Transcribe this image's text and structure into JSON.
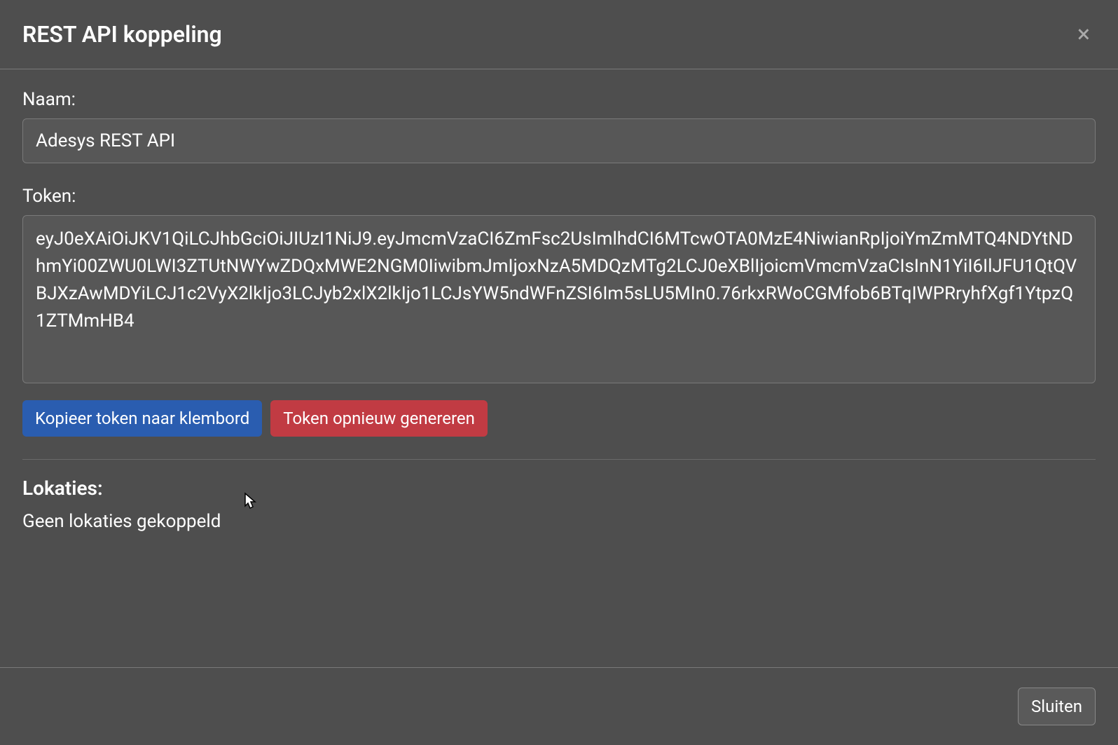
{
  "modal": {
    "title": "REST API koppeling"
  },
  "fields": {
    "name": {
      "label": "Naam:",
      "value": "Adesys REST API"
    },
    "token": {
      "label": "Token:",
      "value": "eyJ0eXAiOiJKV1QiLCJhbGciOiJIUzI1NiJ9.eyJmcmVzaCI6ZmFsc2UsImlhdCI6MTcwOTA0MzE4NiwianRpIjoiYmZmMTQ4NDYtNDhmYi00ZWU0LWI3ZTUtNWYwZDQxMWE2NGM0IiwibmJmIjoxNzA5MDQzMTg2LCJ0eXBlIjoicmVmcmVzaCIsInN1YiI6IlJFU1QtQVBJXzAwMDYiLCJ1c2VyX2lkIjo3LCJyb2xlX2lkIjo1LCJsYW5ndWFnZSI6Im5sLU5MIn0.76rkxRWoCGMfob6BTqIWPRryhfXgf1YtpzQ1ZTMmHB4"
    }
  },
  "buttons": {
    "copy_token": "Kopieer token naar klembord",
    "regenerate_token": "Token opnieuw genereren",
    "close": "Sluiten"
  },
  "locations": {
    "title": "Lokaties:",
    "empty_text": "Geen lokaties gekoppeld"
  }
}
